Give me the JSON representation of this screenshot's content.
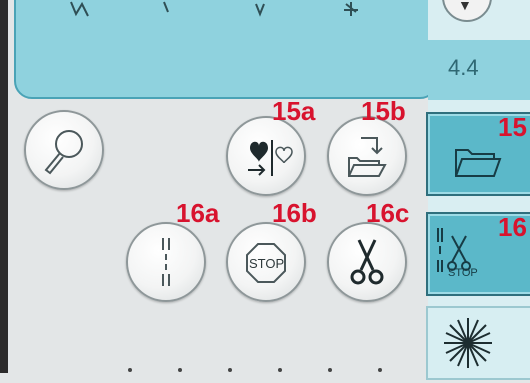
{
  "stitch_width": {
    "value": "4.4"
  },
  "labels": {
    "btn_15a": "15a",
    "btn_15b": "15b",
    "tab_15": "15",
    "btn_16a": "16a",
    "btn_16b": "16b",
    "btn_16c": "16c",
    "tab_16": "16"
  },
  "icons": {
    "zoom": "magnifier-icon",
    "save_favorite": "heart-save-icon",
    "open_file": "folder-in-icon",
    "file_tab": "folder-icon",
    "tie_off": "tie-off-icon",
    "stop": "stop-icon",
    "thread_cut": "scissors-icon",
    "tieoff_cut_tab": "tieoff-stop-cut-icon",
    "stitch_tab": "stitch-pattern-icon"
  },
  "colors": {
    "panel_teal": "#8fd2de",
    "tab_teal": "#5bb8c9",
    "label_red": "#d8132e"
  }
}
